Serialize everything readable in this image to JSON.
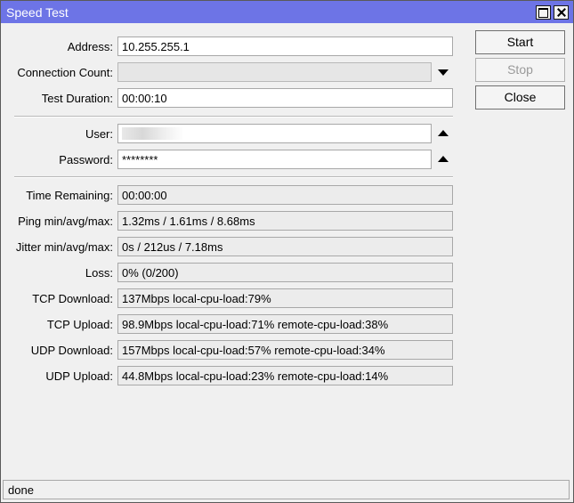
{
  "window": {
    "title": "Speed Test"
  },
  "form": {
    "address": {
      "label": "Address:",
      "value": "10.255.255.1"
    },
    "connection_count": {
      "label": "Connection Count:",
      "value": ""
    },
    "test_duration": {
      "label": "Test Duration:",
      "value": "00:00:10"
    },
    "user": {
      "label": "User:",
      "value": ""
    },
    "password": {
      "label": "Password:",
      "value": "********"
    }
  },
  "results": {
    "time_remaining": {
      "label": "Time Remaining:",
      "value": "00:00:00"
    },
    "ping": {
      "label": "Ping min/avg/max:",
      "value": "1.32ms / 1.61ms / 8.68ms"
    },
    "jitter": {
      "label": "Jitter min/avg/max:",
      "value": "0s / 212us / 7.18ms"
    },
    "loss": {
      "label": "Loss:",
      "value": "0% (0/200)"
    },
    "tcp_download": {
      "label": "TCP Download:",
      "value": "137Mbps local-cpu-load:79%"
    },
    "tcp_upload": {
      "label": "TCP Upload:",
      "value": "98.9Mbps local-cpu-load:71% remote-cpu-load:38%"
    },
    "udp_download": {
      "label": "UDP Download:",
      "value": "157Mbps local-cpu-load:57% remote-cpu-load:34%"
    },
    "udp_upload": {
      "label": "UDP Upload:",
      "value": "44.8Mbps local-cpu-load:23% remote-cpu-load:14%"
    }
  },
  "buttons": {
    "start": "Start",
    "stop": "Stop",
    "close": "Close"
  },
  "status": {
    "text": "done"
  },
  "icons": {
    "connection_count_dropdown": "triangle-down-icon",
    "user_collapse": "triangle-up-icon",
    "password_collapse": "triangle-up-icon"
  }
}
